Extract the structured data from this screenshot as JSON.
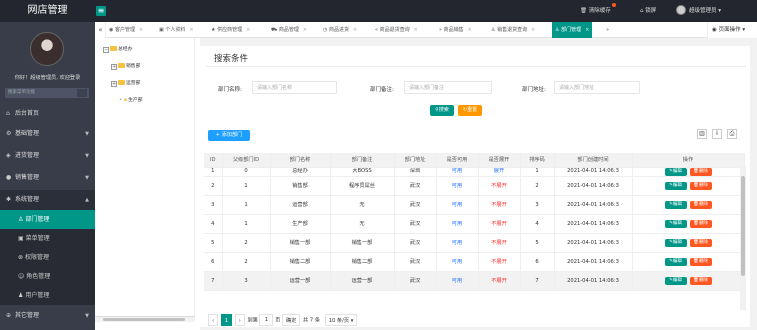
{
  "app": {
    "brand": "网店管理",
    "hamburger": "≡"
  },
  "top_right": {
    "clear_cache": "清除缓存",
    "lock": "锁屏",
    "user": "超级管理员"
  },
  "sidebar": {
    "welcome": "你好！超级管理员, 欢迎登录",
    "search_placeholder": "搜索菜单功能",
    "menus": [
      {
        "label": "后台首页",
        "icon": "⌂"
      },
      {
        "label": "基础管理",
        "icon": "⚙",
        "arrow": "▼"
      },
      {
        "label": "进货管理",
        "icon": "◈",
        "arrow": "▼"
      },
      {
        "label": "销售管理",
        "icon": "●",
        "arrow": "▼"
      },
      {
        "label": "系统管理",
        "icon": "✱",
        "arrow": "▲"
      }
    ],
    "sub_items": [
      {
        "label": "部门管理",
        "icon": "♙"
      },
      {
        "label": "菜单管理",
        "icon": "▣"
      },
      {
        "label": "权限管理",
        "icon": "⊗"
      },
      {
        "label": "角色管理",
        "icon": "☺"
      },
      {
        "label": "用户管理",
        "icon": "♟"
      }
    ],
    "other": {
      "label": "其它管理",
      "icon": "⊕",
      "arrow": "▼"
    }
  },
  "tree": {
    "root": "总经办",
    "children": [
      "销售部",
      "运营部",
      "生产部"
    ]
  },
  "tabs": {
    "items": [
      "客户管理",
      "个人资料",
      "供应商管理",
      "商品管理",
      "商品进货",
      "商品退货查询",
      "商品销售",
      "销售退货查询",
      "部门管理"
    ],
    "page_ops": "页面操作"
  },
  "search": {
    "title": "搜索条件",
    "name_label": "部门名称:",
    "name_placeholder": "请输入部门名称",
    "remark_label": "部门备注:",
    "remark_placeholder": "请输入部门备注",
    "addr_label": "部门地址:",
    "addr_placeholder": "请输入部门地址",
    "search_btn": "搜索",
    "reset_btn": "重置"
  },
  "table": {
    "add_btn": "+ 添加部门",
    "columns": [
      "ID",
      "父级部门ID",
      "部门名称",
      "部门备注",
      "部门地址",
      "是否可用",
      "是否展开",
      "排序码",
      "部门创建时间",
      "操作"
    ],
    "rows": [
      [
        "1",
        "0",
        "总经办",
        "大BOSS",
        "深圳",
        "可用",
        "展开",
        "1",
        "2021-04-01 14:06:3"
      ],
      [
        "2",
        "1",
        "销售部",
        "程序员屌丝",
        "武汉",
        "可用",
        "不展开",
        "2",
        "2021-04-01 14:06:3"
      ],
      [
        "3",
        "1",
        "运营部",
        "无",
        "武汉",
        "可用",
        "不展开",
        "3",
        "2021-04-01 14:06:3"
      ],
      [
        "4",
        "1",
        "生产部",
        "无",
        "武汉",
        "可用",
        "不展开",
        "4",
        "2021-04-01 14:06:3"
      ],
      [
        "5",
        "2",
        "销售一部",
        "销售一部",
        "武汉",
        "可用",
        "不展开",
        "5",
        "2021-04-01 14:06:3"
      ],
      [
        "6",
        "2",
        "销售二部",
        "销售二部",
        "武汉",
        "可用",
        "不展开",
        "6",
        "2021-04-01 14:06:3"
      ],
      [
        "7",
        "3",
        "运营一部",
        "运营一部",
        "武汉",
        "可用",
        "不展开",
        "7",
        "2021-04-01 14:06:3"
      ]
    ],
    "edit": "编辑",
    "delete": "删除"
  },
  "pager": {
    "current": "1",
    "goto": "到第",
    "goto_value": "1",
    "page_unit": "页",
    "confirm": "确定",
    "total": "共 7 条",
    "per_page": "10 条/页"
  },
  "colors": {
    "accent": "#009688",
    "sidebar": "#393d49",
    "danger": "#ff5722",
    "primary": "#1e9fff",
    "warm": "#ff9800"
  }
}
